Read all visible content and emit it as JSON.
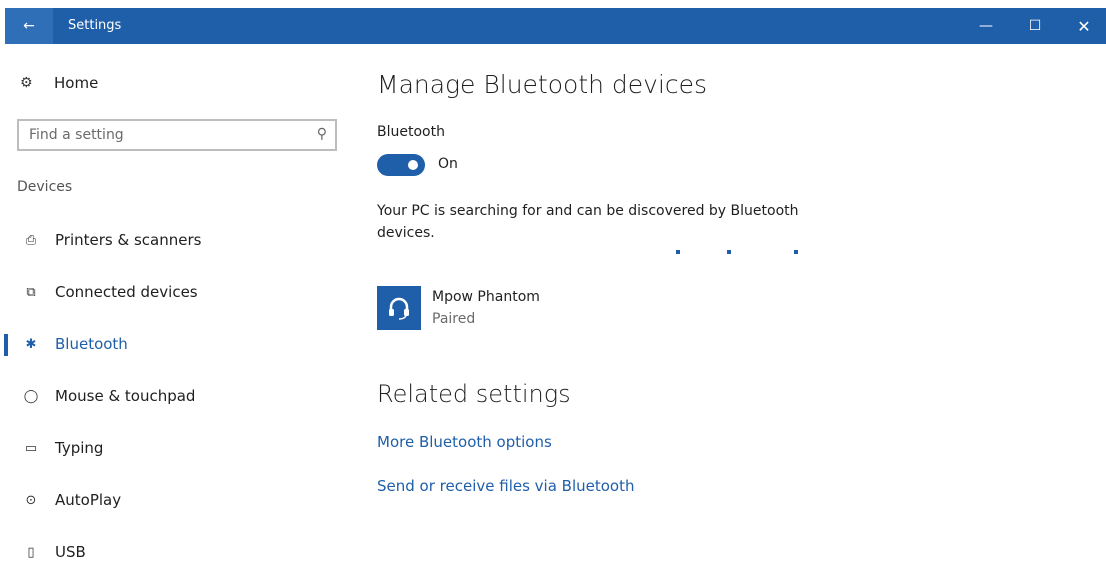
{
  "titlebar": {
    "back_icon": "back-arrow-icon",
    "back_glyph": "←",
    "title": "Settings",
    "minimize_glyph": "—",
    "maximize_glyph": "☐",
    "close_glyph": "✕",
    "color": "#1f5fa9"
  },
  "sidebar": {
    "home": {
      "label": "Home",
      "icon": "gear-icon",
      "glyph": "⚙"
    },
    "search": {
      "placeholder": "Find a setting",
      "icon": "search-icon",
      "glyph": "⚲"
    },
    "section_label": "Devices",
    "items": [
      {
        "label": "Printers & scanners",
        "icon": "printer-icon",
        "glyph": "⎙",
        "active": false
      },
      {
        "label": "Connected devices",
        "icon": "connected-devices-icon",
        "glyph": "⧉",
        "active": false
      },
      {
        "label": "Bluetooth",
        "icon": "bluetooth-icon",
        "glyph": "✱",
        "active": true
      },
      {
        "label": "Mouse & touchpad",
        "icon": "mouse-icon",
        "glyph": "◯",
        "active": false
      },
      {
        "label": "Typing",
        "icon": "keyboard-icon",
        "glyph": "▭",
        "active": false
      },
      {
        "label": "AutoPlay",
        "icon": "autoplay-icon",
        "glyph": "⊙",
        "active": false
      },
      {
        "label": "USB",
        "icon": "usb-icon",
        "glyph": "▯",
        "active": false
      }
    ]
  },
  "main": {
    "title": "Manage Bluetooth devices",
    "bluetooth_label": "Bluetooth",
    "toggle": {
      "state": "On",
      "on": true
    },
    "status_text": "Your PC is searching for and can be discovered by Bluetooth devices.",
    "device": {
      "name": "Mpow Phantom",
      "status": "Paired",
      "icon": "headset-icon",
      "glyph": "🎧"
    },
    "related_title": "Related settings",
    "links": [
      "More Bluetooth options",
      "Send or receive files via Bluetooth"
    ]
  }
}
